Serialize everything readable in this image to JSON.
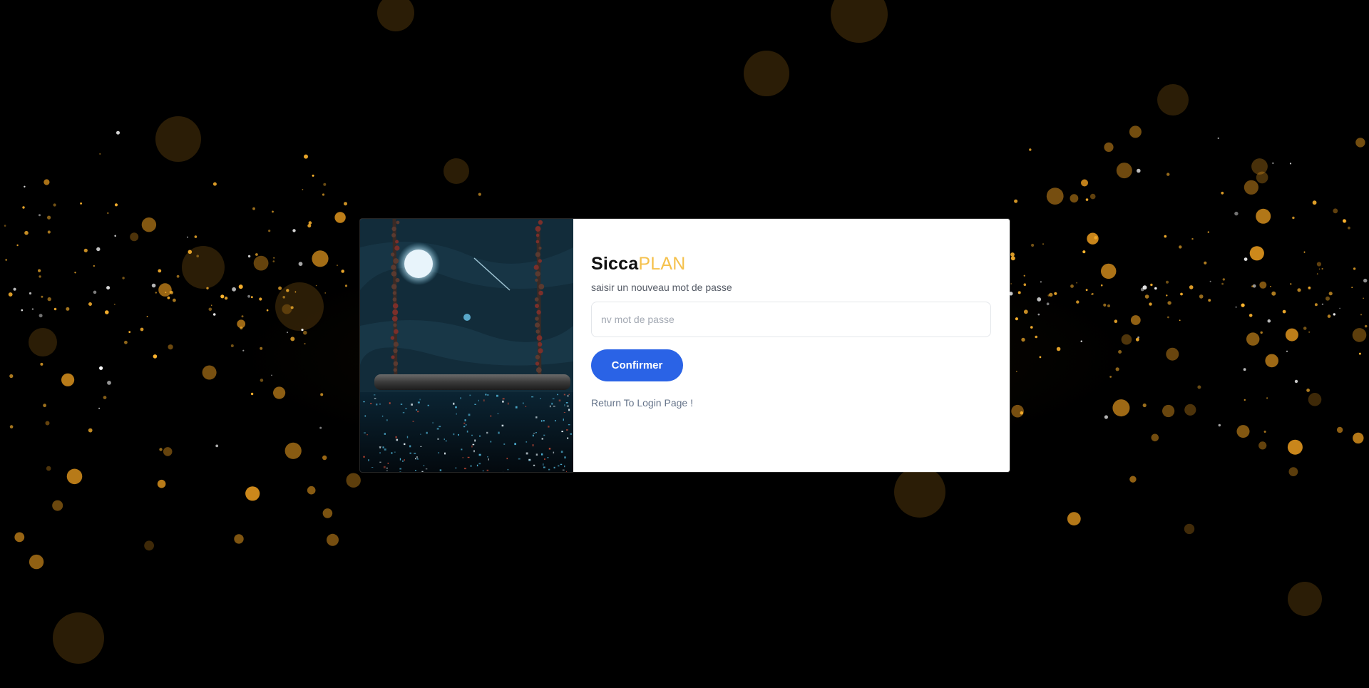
{
  "brand": {
    "part1": "Sicca",
    "part2": "PLAN",
    "part2_color": "#f5c14c"
  },
  "form": {
    "subtitle": "saisir un nouveau mot de passe",
    "password_placeholder": "nv mot de passe",
    "password_value": "",
    "confirm_label": "Confirmer",
    "return_link": "Return To Login Page !"
  },
  "colors": {
    "background": "#000000",
    "card": "#ffffff",
    "button": "#2a63e6",
    "bokeh": "#f0a020"
  }
}
